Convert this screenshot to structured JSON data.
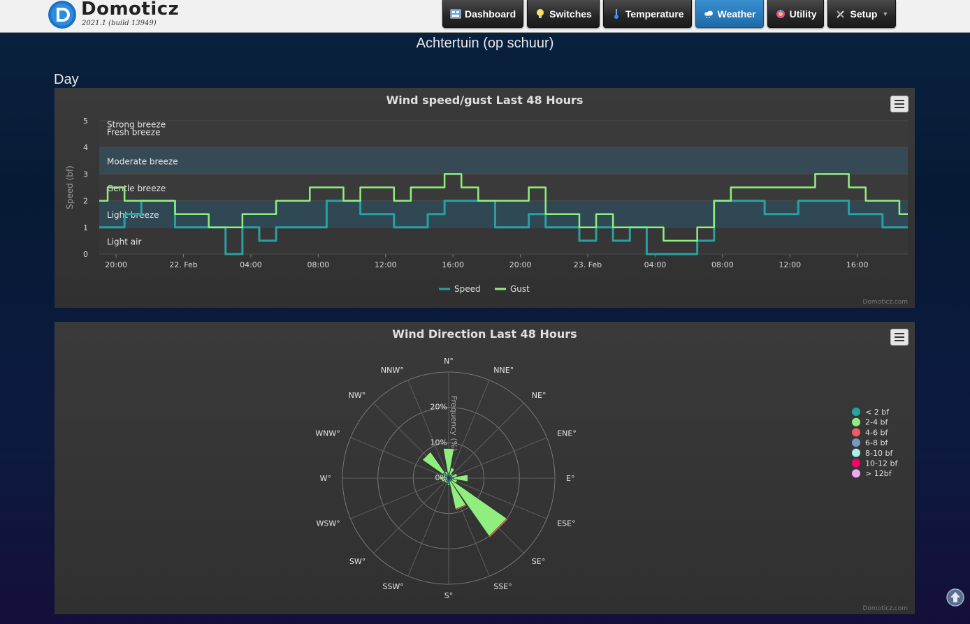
{
  "header": {
    "brand": "Domoticz",
    "version": "2021.1 (build 13949)",
    "nav": [
      {
        "label": "Dashboard",
        "icon": "dashboard-icon",
        "active": false
      },
      {
        "label": "Switches",
        "icon": "lightbulb-icon",
        "active": false
      },
      {
        "label": "Temperature",
        "icon": "thermometer-icon",
        "active": false
      },
      {
        "label": "Weather",
        "icon": "cloud-icon",
        "active": true
      },
      {
        "label": "Utility",
        "icon": "utility-icon",
        "active": false
      },
      {
        "label": "Setup",
        "icon": "tools-icon",
        "active": false
      }
    ]
  },
  "page": {
    "title": "Achtertuin (op schuur)",
    "section": "Day"
  },
  "credit": "Domoticz.com",
  "colors": {
    "speed": "#2aa0a0",
    "gust": "#90ee7e",
    "accent": "#1e6aa8"
  },
  "chart_data": [
    {
      "type": "line",
      "title": "Wind speed/gust Last 48 Hours",
      "ylabel": "Speed (bf)",
      "ylim": [
        0,
        5
      ],
      "yticks": [
        0,
        1,
        2,
        3,
        4,
        5
      ],
      "xlim": [
        "2021-02-21 19:00",
        "2021-02-23 19:00"
      ],
      "xticks": [
        "20:00",
        "22. Feb",
        "04:00",
        "08:00",
        "12:00",
        "16:00",
        "20:00",
        "23. Feb",
        "04:00",
        "08:00",
        "12:00",
        "16:00"
      ],
      "bands": [
        "Light air",
        "Light breeze",
        "Gentle breeze",
        "Moderate breeze",
        "Fresh breeze",
        "Strong breeze"
      ],
      "legend": [
        "Speed",
        "Gust"
      ],
      "series": [
        {
          "name": "Speed",
          "values": [
            [
              "2021-02-21 19:00",
              1
            ],
            [
              "2021-02-21 20:00",
              1
            ],
            [
              "2021-02-21 21:00",
              1.5
            ],
            [
              "2021-02-21 22:00",
              2
            ],
            [
              "2021-02-21 23:00",
              2
            ],
            [
              "2021-02-22 00:00",
              1
            ],
            [
              "2021-02-22 01:00",
              1
            ],
            [
              "2021-02-22 02:00",
              1
            ],
            [
              "2021-02-22 03:00",
              0
            ],
            [
              "2021-02-22 04:00",
              1
            ],
            [
              "2021-02-22 05:00",
              0.5
            ],
            [
              "2021-02-22 06:00",
              1
            ],
            [
              "2021-02-22 07:00",
              1
            ],
            [
              "2021-02-22 08:00",
              1
            ],
            [
              "2021-02-22 09:00",
              2
            ],
            [
              "2021-02-22 10:00",
              2
            ],
            [
              "2021-02-22 11:00",
              1.5
            ],
            [
              "2021-02-22 12:00",
              1.5
            ],
            [
              "2021-02-22 13:00",
              1
            ],
            [
              "2021-02-22 14:00",
              1
            ],
            [
              "2021-02-22 15:00",
              1.5
            ],
            [
              "2021-02-22 16:00",
              2
            ],
            [
              "2021-02-22 17:00",
              2
            ],
            [
              "2021-02-22 18:00",
              2
            ],
            [
              "2021-02-22 19:00",
              1
            ],
            [
              "2021-02-22 20:00",
              1
            ],
            [
              "2021-02-22 21:00",
              1.5
            ],
            [
              "2021-02-22 22:00",
              1
            ],
            [
              "2021-02-22 23:00",
              1
            ],
            [
              "2021-02-23 00:00",
              0.5
            ],
            [
              "2021-02-23 01:00",
              1
            ],
            [
              "2021-02-23 02:00",
              0.5
            ],
            [
              "2021-02-23 03:00",
              1
            ],
            [
              "2021-02-23 04:00",
              0
            ],
            [
              "2021-02-23 05:00",
              0
            ],
            [
              "2021-02-23 06:00",
              0
            ],
            [
              "2021-02-23 07:00",
              0.5
            ],
            [
              "2021-02-23 08:00",
              2
            ],
            [
              "2021-02-23 09:00",
              2
            ],
            [
              "2021-02-23 10:00",
              2
            ],
            [
              "2021-02-23 11:00",
              1.5
            ],
            [
              "2021-02-23 12:00",
              1.5
            ],
            [
              "2021-02-23 13:00",
              2
            ],
            [
              "2021-02-23 14:00",
              2
            ],
            [
              "2021-02-23 15:00",
              2
            ],
            [
              "2021-02-23 16:00",
              1.5
            ],
            [
              "2021-02-23 17:00",
              1.5
            ],
            [
              "2021-02-23 18:00",
              1
            ],
            [
              "2021-02-23 19:00",
              1
            ]
          ]
        },
        {
          "name": "Gust",
          "values": [
            [
              "2021-02-21 19:00",
              2
            ],
            [
              "2021-02-21 20:00",
              2.5
            ],
            [
              "2021-02-21 21:00",
              2
            ],
            [
              "2021-02-21 22:00",
              2
            ],
            [
              "2021-02-21 23:00",
              2
            ],
            [
              "2021-02-22 00:00",
              1.5
            ],
            [
              "2021-02-22 01:00",
              1.5
            ],
            [
              "2021-02-22 02:00",
              1
            ],
            [
              "2021-02-22 03:00",
              1
            ],
            [
              "2021-02-22 04:00",
              1.5
            ],
            [
              "2021-02-22 05:00",
              1.5
            ],
            [
              "2021-02-22 06:00",
              2
            ],
            [
              "2021-02-22 07:00",
              2
            ],
            [
              "2021-02-22 08:00",
              2.5
            ],
            [
              "2021-02-22 09:00",
              2.5
            ],
            [
              "2021-02-22 10:00",
              2
            ],
            [
              "2021-02-22 11:00",
              2.5
            ],
            [
              "2021-02-22 12:00",
              2.5
            ],
            [
              "2021-02-22 13:00",
              2
            ],
            [
              "2021-02-22 14:00",
              2.5
            ],
            [
              "2021-02-22 15:00",
              2.5
            ],
            [
              "2021-02-22 16:00",
              3
            ],
            [
              "2021-02-22 17:00",
              2.5
            ],
            [
              "2021-02-22 18:00",
              2
            ],
            [
              "2021-02-22 19:00",
              2
            ],
            [
              "2021-02-22 20:00",
              2
            ],
            [
              "2021-02-22 21:00",
              2.5
            ],
            [
              "2021-02-22 22:00",
              1.5
            ],
            [
              "2021-02-22 23:00",
              1.5
            ],
            [
              "2021-02-23 00:00",
              1
            ],
            [
              "2021-02-23 01:00",
              1.5
            ],
            [
              "2021-02-23 02:00",
              1
            ],
            [
              "2021-02-23 03:00",
              1
            ],
            [
              "2021-02-23 04:00",
              1
            ],
            [
              "2021-02-23 05:00",
              0.5
            ],
            [
              "2021-02-23 06:00",
              0.5
            ],
            [
              "2021-02-23 07:00",
              1
            ],
            [
              "2021-02-23 08:00",
              2
            ],
            [
              "2021-02-23 09:00",
              2.5
            ],
            [
              "2021-02-23 10:00",
              2.5
            ],
            [
              "2021-02-23 11:00",
              2.5
            ],
            [
              "2021-02-23 12:00",
              2.5
            ],
            [
              "2021-02-23 13:00",
              2.5
            ],
            [
              "2021-02-23 14:00",
              3
            ],
            [
              "2021-02-23 15:00",
              3
            ],
            [
              "2021-02-23 16:00",
              2.5
            ],
            [
              "2021-02-23 17:00",
              2
            ],
            [
              "2021-02-23 18:00",
              2
            ],
            [
              "2021-02-23 19:00",
              1.5
            ]
          ]
        }
      ]
    },
    {
      "type": "polar-bar",
      "title": "Wind Direction Last 48 Hours",
      "radial_label": "Frequency (%)",
      "rlim": [
        0,
        30
      ],
      "rticks": [
        "0%",
        "10%",
        "20%"
      ],
      "directions": [
        "N°",
        "NNE°",
        "NE°",
        "ENE°",
        "E°",
        "ESE°",
        "SE°",
        "SSE°",
        "S°",
        "SSW°",
        "SW°",
        "WSW°",
        "W°",
        "WNW°",
        "NW°",
        "NNW°"
      ],
      "legend": [
        "< 2 bf",
        "2-4 bf",
        "4-6 bf",
        "6-8 bf",
        "8-10 bf",
        "10-12 bf",
        "> 12bf"
      ],
      "legend_colors": [
        "#2aa0a0",
        "#90ee7e",
        "#f45b5b",
        "#7798bf",
        "#aaeeee",
        "#ff0066",
        "#eeaaee"
      ],
      "series": [
        {
          "name": "< 2 bf",
          "values": [
            1.5,
            1,
            1,
            1,
            1.5,
            1,
            1,
            1,
            1.5,
            1,
            1,
            1,
            1.5,
            1,
            2,
            1
          ]
        },
        {
          "name": "2-4 bf",
          "values": [
            7,
            2,
            0.5,
            1.5,
            4,
            1.5,
            19,
            8,
            0.5,
            0.5,
            0.5,
            1,
            1,
            0.5,
            7,
            1
          ]
        },
        {
          "name": "4-6 bf",
          "values": [
            0,
            0,
            0,
            0,
            0,
            0,
            0.4,
            0.3,
            0,
            0,
            0,
            0,
            0,
            0,
            0,
            0
          ]
        }
      ]
    }
  ]
}
